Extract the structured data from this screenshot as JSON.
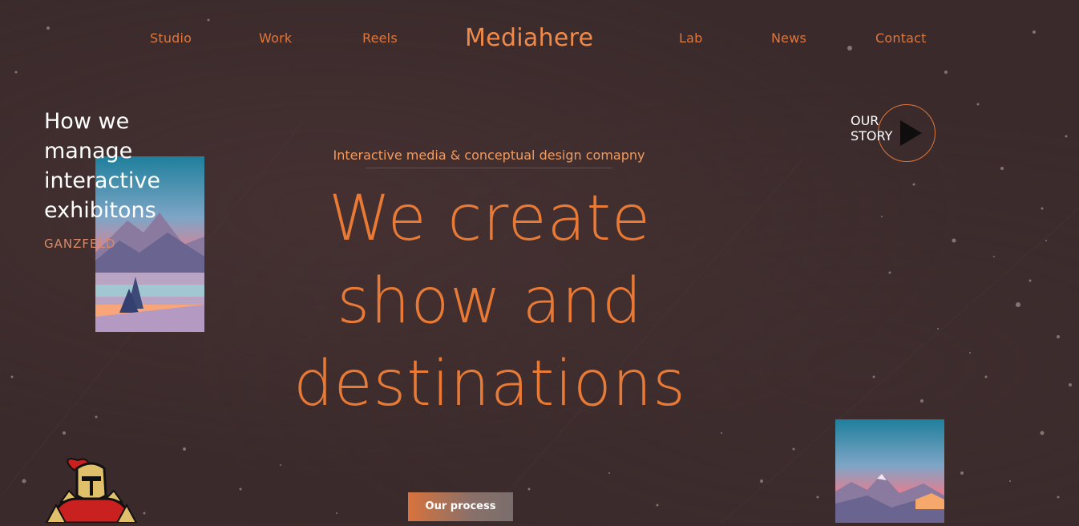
{
  "nav": {
    "left": [
      "Studio",
      "Work",
      "Reels"
    ],
    "brand": "Mediahere",
    "right": [
      "Lab",
      "News",
      "Contact"
    ]
  },
  "side": {
    "heading_lines": [
      "How we",
      "manage",
      "interactive",
      "exhibitons"
    ],
    "subtitle": "GANZFELD"
  },
  "hero": {
    "tagline": "Interactive media & conceptual design comapny",
    "headline_lines": [
      "We create",
      "show and",
      "destinations"
    ]
  },
  "story": {
    "line1": "OUR",
    "line2": "STORY",
    "icon": "play-icon"
  },
  "cta": {
    "process_label": "Our process"
  },
  "colors": {
    "background": "#3a2a2b",
    "accent": "#e87a35",
    "heading_white": "#ffffff"
  },
  "images": [
    "mountain-lake-thumbnail",
    "mountain-sunset-thumbnail",
    "knight-mascot-logo"
  ]
}
